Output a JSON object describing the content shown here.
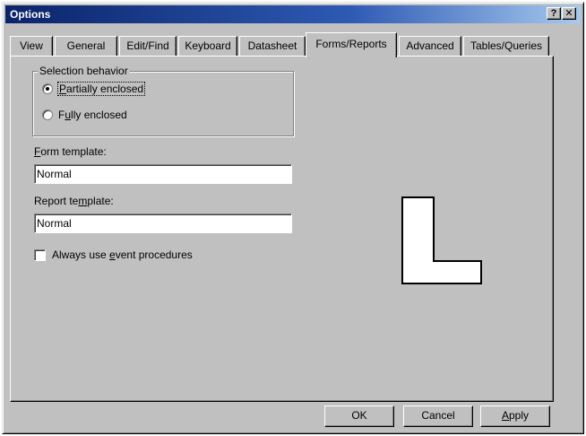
{
  "window": {
    "title": "Options",
    "help_glyph": "?",
    "close_glyph": "✕"
  },
  "tabs": [
    {
      "label": "View",
      "active": false
    },
    {
      "label": "General",
      "active": false
    },
    {
      "label": "Edit/Find",
      "active": false
    },
    {
      "label": "Keyboard",
      "active": false
    },
    {
      "label": "Datasheet",
      "active": false
    },
    {
      "label": "Forms/Reports",
      "active": true
    },
    {
      "label": "Advanced",
      "active": false
    },
    {
      "label": "Tables/Queries",
      "active": false
    }
  ],
  "selection_behavior": {
    "legend": "Selection behavior",
    "partial": {
      "pre": "",
      "key": "P",
      "post": "artially enclosed",
      "selected": true
    },
    "full": {
      "pre": "F",
      "key": "u",
      "post": "lly enclosed",
      "selected": false
    }
  },
  "form_template": {
    "label_key": "F",
    "label_rest": "orm template:",
    "value": "Normal"
  },
  "report_template": {
    "label_pre": "Report te",
    "label_key": "m",
    "label_post": "plate:",
    "value": "Normal"
  },
  "event_procedures": {
    "pre": "Always use ",
    "key": "e",
    "post": "vent procedures",
    "checked": false
  },
  "buttons": {
    "ok": "OK",
    "cancel": "Cancel",
    "apply_key": "A",
    "apply_rest": "pply"
  },
  "icons": {
    "preview": "l-shape-selection-preview-icon"
  }
}
